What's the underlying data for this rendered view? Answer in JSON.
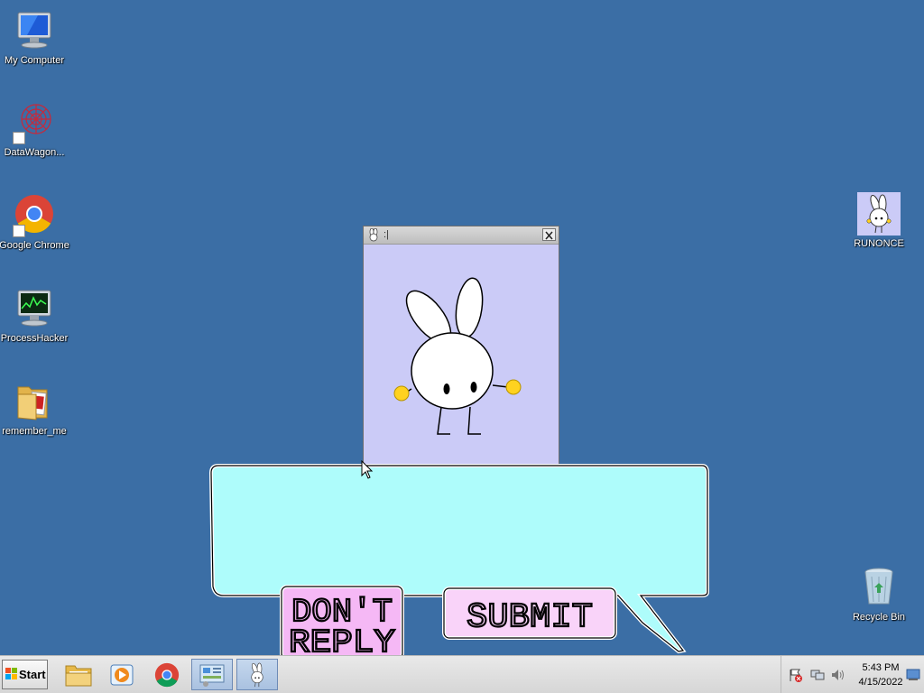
{
  "desktop": {
    "background": "#3b6ea5",
    "icons_left": [
      {
        "label": "My Computer",
        "icon": "my-computer-icon"
      },
      {
        "label": "DataWagon...",
        "icon": "datawagon-icon"
      },
      {
        "label": "Google Chrome",
        "icon": "chrome-icon"
      },
      {
        "label": "ProcessHacker",
        "icon": "process-hacker-icon"
      },
      {
        "label": "remember_me",
        "icon": "folder-icon"
      }
    ],
    "icons_right": [
      {
        "label": "RUNONCE",
        "icon": "bunny-icon"
      },
      {
        "label": "Recycle Bin",
        "icon": "recycle-bin-icon"
      }
    ]
  },
  "window": {
    "title": ":|",
    "background": "#cbcbf7",
    "close_icon": "close-icon"
  },
  "dialog": {
    "bubble_color": "#aefcfb",
    "button_color": "#f5b8f5",
    "dont_reply_line1": "DON'T",
    "dont_reply_line2": "REPLY",
    "submit_label": "SUBMIT"
  },
  "taskbar": {
    "start_label": "Start",
    "pinned": [
      "explorer-icon",
      "media-player-icon",
      "chrome-icon",
      "control-panel-icon",
      "bunny-icon"
    ],
    "clock_time": "5:43 PM",
    "clock_date": "4/15/2022",
    "tray_icons": [
      "action-center-icon",
      "network-icon",
      "volume-icon"
    ]
  }
}
